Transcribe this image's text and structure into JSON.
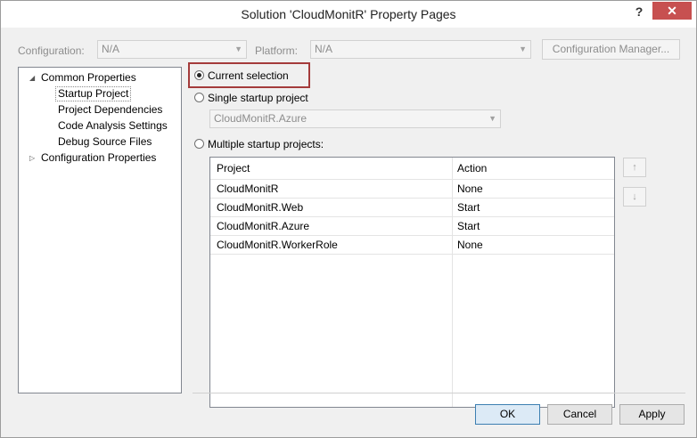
{
  "window": {
    "title": "Solution 'CloudMonitR' Property Pages",
    "help": "?",
    "close": "✕"
  },
  "config_bar": {
    "configuration_label": "Configuration:",
    "configuration_value": "N/A",
    "platform_label": "Platform:",
    "platform_value": "N/A",
    "manager_button": "Configuration Manager..."
  },
  "tree": {
    "items": [
      {
        "label": "Common Properties",
        "expander": "◢"
      },
      {
        "label": "Startup Project"
      },
      {
        "label": "Project Dependencies"
      },
      {
        "label": "Code Analysis Settings"
      },
      {
        "label": "Debug Source Files"
      },
      {
        "label": "Configuration Properties",
        "expander": "▷"
      }
    ]
  },
  "startup": {
    "current_selection": "Current selection",
    "single_startup": "Single startup project",
    "single_value": "CloudMonitR.Azure",
    "multiple_startup": "Multiple startup projects:",
    "selected_option": "current_selection"
  },
  "grid": {
    "columns": [
      "Project",
      "Action"
    ],
    "rows": [
      {
        "project": "CloudMonitR",
        "action": "None"
      },
      {
        "project": "CloudMonitR.Web",
        "action": "Start"
      },
      {
        "project": "CloudMonitR.Azure",
        "action": "Start"
      },
      {
        "project": "CloudMonitR.WorkerRole",
        "action": "None"
      }
    ]
  },
  "move": {
    "up": "↑",
    "down": "↓"
  },
  "footer": {
    "ok": "OK",
    "cancel": "Cancel",
    "apply": "Apply"
  },
  "colors": {
    "close_bg": "#c75050",
    "highlight_border": "#a43b3b",
    "ok_border": "#3c7fb1"
  }
}
